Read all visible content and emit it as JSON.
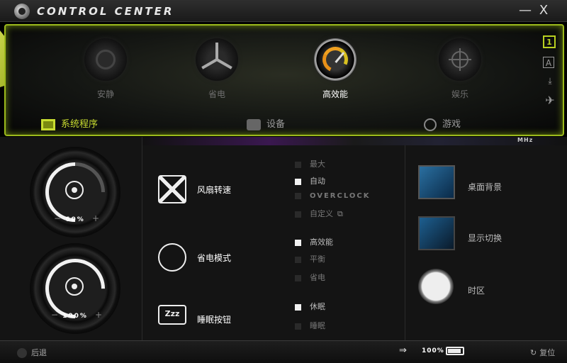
{
  "window": {
    "title": "CONTROL CENTER",
    "minimize": "—",
    "close": "X"
  },
  "modes": [
    {
      "label": "安静",
      "icon": "speaker-icon",
      "active": false
    },
    {
      "label": "省电",
      "icon": "fan-icon",
      "active": false
    },
    {
      "label": "高效能",
      "icon": "gauge-icon",
      "active": true
    },
    {
      "label": "娱乐",
      "icon": "crosshair-icon",
      "active": false
    }
  ],
  "side_profiles": [
    "1",
    "A",
    "⤓",
    "✈"
  ],
  "tabs": [
    {
      "label": "系统程序",
      "icon": "monitor-icon",
      "active": true
    },
    {
      "label": "设备",
      "icon": "plug-icon",
      "active": false
    },
    {
      "label": "游戏",
      "icon": "steering-wheel-icon",
      "active": false
    }
  ],
  "strip_label": "MHz",
  "dials": [
    {
      "value": "60%",
      "icon": "volume-knob-icon"
    },
    {
      "value": "100%",
      "icon": "brightness-icon"
    }
  ],
  "features": [
    {
      "label": "风扇转速",
      "icon": "fan-icon"
    },
    {
      "label": "省电模式",
      "icon": "power-saving-icon"
    },
    {
      "label": "睡眠按钮",
      "icon": "sleep-icon",
      "icon_text": "Zzz"
    }
  ],
  "fan_options": [
    {
      "label": "最大",
      "checked": false
    },
    {
      "label": "自动",
      "checked": true
    },
    {
      "label": "OVERCLOCK",
      "checked": false
    },
    {
      "label": "自定义",
      "checked": false
    }
  ],
  "power_options": [
    {
      "label": "高效能",
      "checked": true
    },
    {
      "label": "平衡",
      "checked": false
    },
    {
      "label": "省电",
      "checked": false
    }
  ],
  "sleep_options": [
    {
      "label": "休眠",
      "checked": true
    },
    {
      "label": "睡眠",
      "checked": false
    }
  ],
  "right_items": [
    {
      "label": "桌面背景",
      "icon": "windows-desktop-icon"
    },
    {
      "label": "显示切换",
      "icon": "display-switch-icon"
    },
    {
      "label": "时区",
      "icon": "clock-icon"
    }
  ],
  "bottom": {
    "back": "后退",
    "battery": "100%",
    "reset": "复位"
  },
  "colors": {
    "accent": "#b8d020",
    "frame": "#9cba1c",
    "gauge": "#f0a020"
  }
}
